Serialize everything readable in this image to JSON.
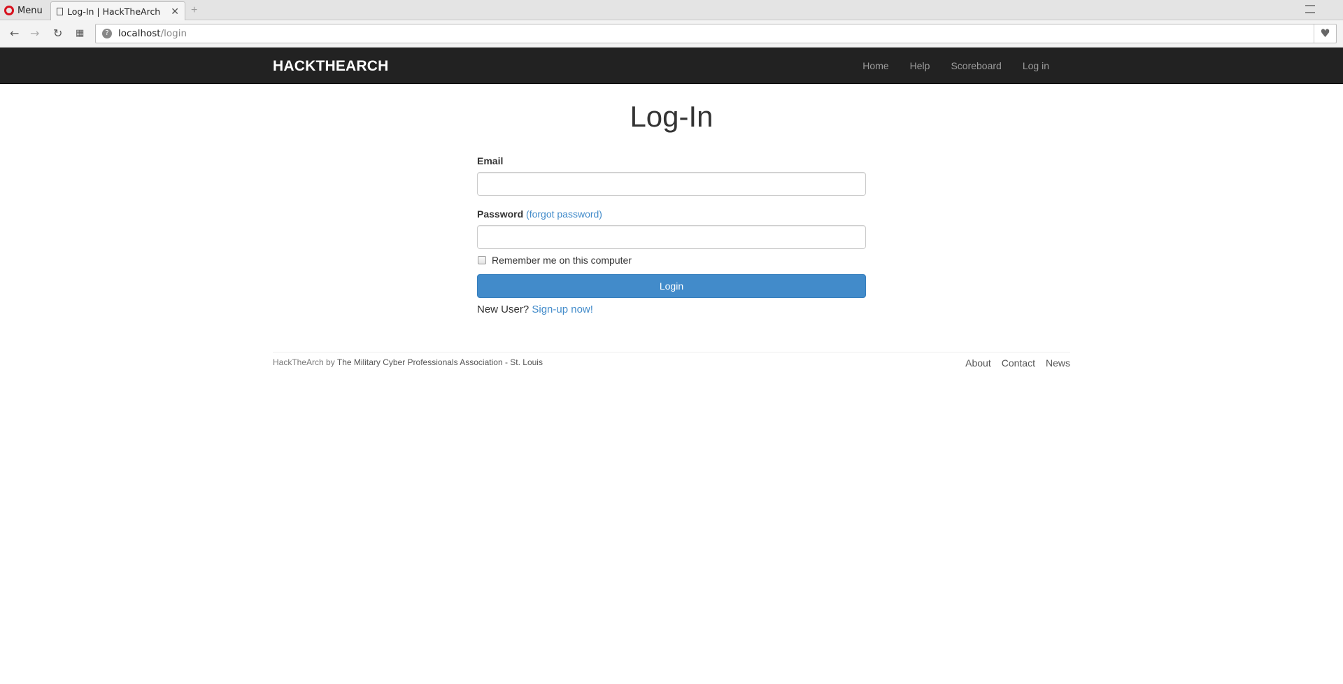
{
  "browser": {
    "menu_label": "Menu",
    "tab_title": "Log-In | HackTheArch",
    "tab_close": "✕",
    "new_tab": "+",
    "url_host": "localhost",
    "url_path": "/login"
  },
  "navbar": {
    "brand": "HACKTHEARCH",
    "links": [
      "Home",
      "Help",
      "Scoreboard",
      "Log in"
    ]
  },
  "main": {
    "title": "Log-In",
    "email_label": "Email",
    "email_value": "",
    "password_label": "Password",
    "forgot_label": "(forgot password)",
    "password_value": "",
    "remember_label": "Remember me on this computer",
    "remember_checked": false,
    "login_button": "Login",
    "new_user_text": "New User?",
    "signup_link": "Sign-up now!"
  },
  "footer": {
    "site": "HackTheArch",
    "by": "by",
    "org": "The Military Cyber Professionals Association - St. Louis",
    "links": [
      "About",
      "Contact",
      "News"
    ]
  },
  "colors": {
    "navbar_bg": "#222222",
    "primary": "#428bca",
    "link": "#428bca"
  },
  "icons": {
    "back": "arrow-left-icon",
    "forward": "arrow-right-icon",
    "reload": "reload-icon",
    "speed_dial": "grid-icon",
    "site_info": "site-info-icon",
    "bookmark": "heart-icon",
    "tab_doc": "document-icon"
  }
}
